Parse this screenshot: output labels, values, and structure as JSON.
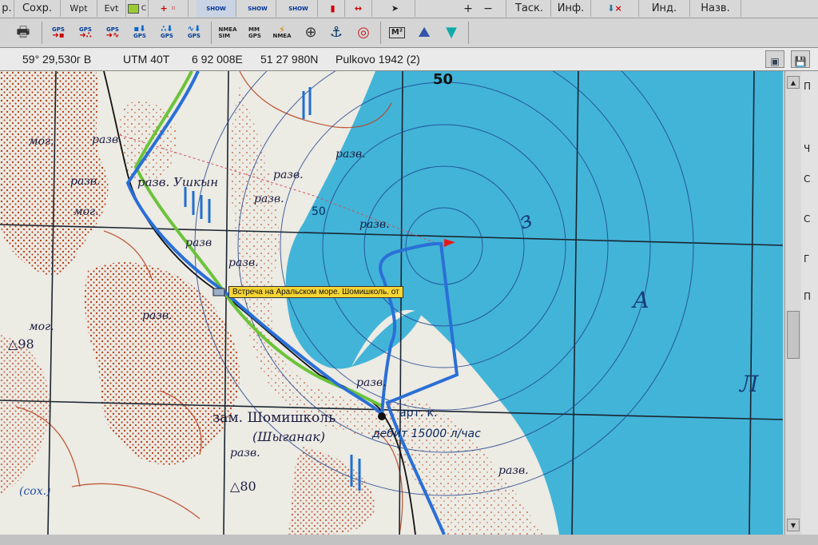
{
  "toolbar1": {
    "items": [
      "р.",
      "Сохр.",
      "Wpt",
      "Evt",
      "C",
      "SHOW",
      "SHOW",
      "SHOW",
      "Таск.",
      "Инф.",
      "Инд.",
      "Назв."
    ]
  },
  "toolbar2": {
    "buttons": [
      {
        "icon": "printer-icon"
      },
      {
        "label": "GPS",
        "icon": "gps-download-waypoints-icon"
      },
      {
        "label": "GPS",
        "icon": "gps-download-tracks-icon"
      },
      {
        "label": "GPS",
        "icon": "gps-download-routes-icon"
      },
      {
        "label": "GPS",
        "icon": "gps-upload-waypoints-icon"
      },
      {
        "label": "GPS",
        "icon": "gps-upload-tracks-icon"
      },
      {
        "label": "GPS",
        "icon": "gps-upload-routes-icon"
      },
      {
        "label": "NMEA\nSIM",
        "icon": "nmea-sim-icon"
      },
      {
        "label": "MM\nGPS",
        "icon": "moving-map-gps-icon"
      },
      {
        "label": "NMEA",
        "icon": "nmea-icon"
      },
      {
        "icon": "crosshair-icon"
      },
      {
        "icon": "anchor-icon"
      },
      {
        "icon": "lifebuoy-icon"
      },
      {
        "label": "M²",
        "icon": "area-measure-icon"
      },
      {
        "icon": "elevation-profile-icon"
      },
      {
        "icon": "funnel-icon"
      }
    ]
  },
  "coords": {
    "lat": "59° 29,530г В",
    "utm_zone": "UTM  40T",
    "easting": "6 92 008E",
    "northing": "51 27 980N",
    "datum": "Pulkovo 1942 (2)"
  },
  "map": {
    "tooltip": "Встреча на Аральском море. Шомишколь. от",
    "labels": {
      "l1": "разв.",
      "l2": "мог.",
      "l3": "разв.",
      "l4": "разв. Ушкын",
      "l5": "мог.",
      "l6": "разв.",
      "l7": "разв",
      "l8": "разв.",
      "l9": "разв.",
      "l10": "разв.",
      "l11": "мог.",
      "l12": "98",
      "l13": "зам. Шомишколь",
      "l14": "(Шыганак)",
      "l15": "разв.",
      "l16": "80",
      "l17": "арт. к.",
      "l18": "дебит 15000 л/час",
      "l19": "разв.",
      "l20": "разв.",
      "l21": "50",
      "l22": "50",
      "l23": "з",
      "l24": "А",
      "l25": "Л",
      "l26": "(сох.)",
      "l27": "разв.",
      "l28": "разв."
    }
  },
  "panel": {
    "labels": [
      "П",
      "Ч",
      "С",
      "С",
      "Г",
      "П"
    ]
  },
  "colors": {
    "water": "#42b4d8",
    "land": "#ecebe4",
    "track": "#2a6fd6",
    "dots": "#b8431e"
  }
}
